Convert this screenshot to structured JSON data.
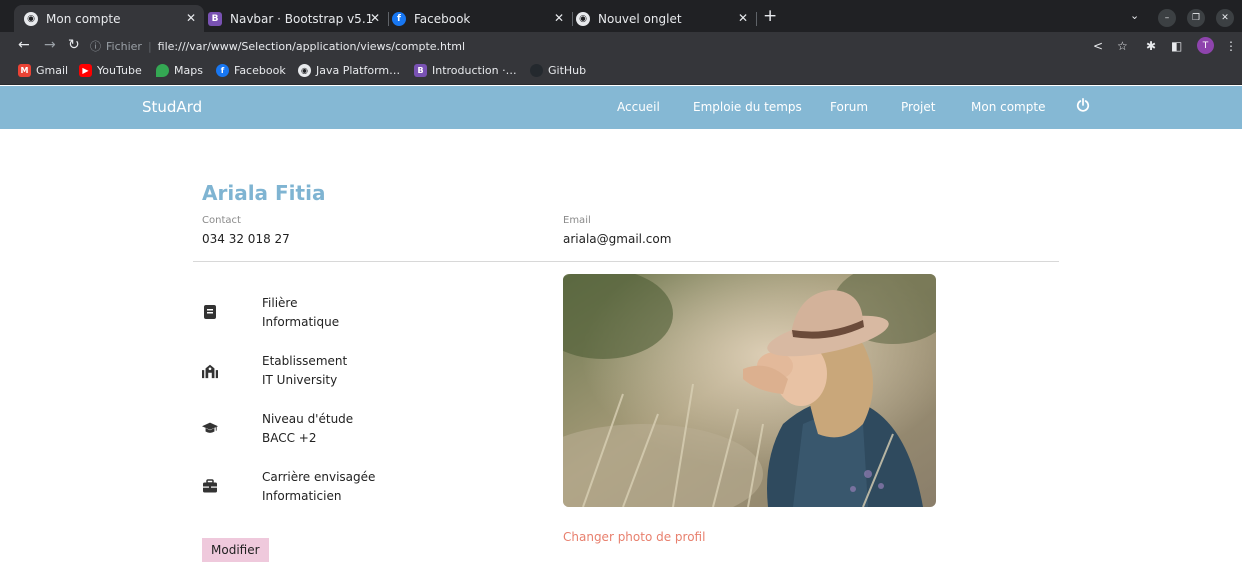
{
  "browser": {
    "tabs": [
      {
        "title": "Mon compte",
        "active": true,
        "icon": "chrome-icon"
      },
      {
        "title": "Navbar · Bootstrap v5.1",
        "active": false,
        "icon": "bootstrap-icon"
      },
      {
        "title": "Facebook",
        "active": false,
        "icon": "facebook-icon"
      },
      {
        "title": "Nouvel onglet",
        "active": false,
        "icon": "chrome-icon"
      }
    ],
    "address": {
      "scheme_label": "Fichier",
      "url": "file:///var/www/Selection/application/views/compte.html"
    },
    "profile_initial": "T",
    "bookmarks": [
      {
        "label": "Gmail",
        "icon": "gmail-icon",
        "color": "#ea4335"
      },
      {
        "label": "YouTube",
        "icon": "youtube-icon",
        "color": "#ff0000"
      },
      {
        "label": "Maps",
        "icon": "maps-icon",
        "color": "#34a853"
      },
      {
        "label": "Facebook",
        "icon": "facebook-icon",
        "color": "#1877f2"
      },
      {
        "label": "Java Platform…",
        "icon": "chrome-icon",
        "color": "#5f6368"
      },
      {
        "label": "Introduction ·…",
        "icon": "bootstrap-icon",
        "color": "#7952b3"
      },
      {
        "label": "GitHub",
        "icon": "github-icon",
        "color": "#24292e"
      }
    ]
  },
  "navbar": {
    "brand": "StudArd",
    "links": [
      "Accueil",
      "Emploie du temps",
      "Forum",
      "Projet",
      "Mon compte"
    ],
    "background": "#85b8d4"
  },
  "profile": {
    "name": "Ariala Fitia",
    "contact_label": "Contact",
    "contact_value": "034 32 018 27",
    "email_label": "Email",
    "email_value": "ariala@gmail.com",
    "details": [
      {
        "title": "Filière",
        "value": "Informatique",
        "icon": "book-icon"
      },
      {
        "title": "Etablissement",
        "value": "IT University",
        "icon": "university-icon"
      },
      {
        "title": "Niveau d'étude",
        "value": "BACC +2",
        "icon": "graduation-cap-icon"
      },
      {
        "title": "Carrière envisagée",
        "value": "Informaticien",
        "icon": "briefcase-icon"
      }
    ],
    "change_photo_label": "Changer photo de profil",
    "modify_label": "Modifier"
  },
  "colors": {
    "name": "#7fb4d2",
    "change_photo": "#e8806e",
    "modify_button": "#efc9dc"
  }
}
